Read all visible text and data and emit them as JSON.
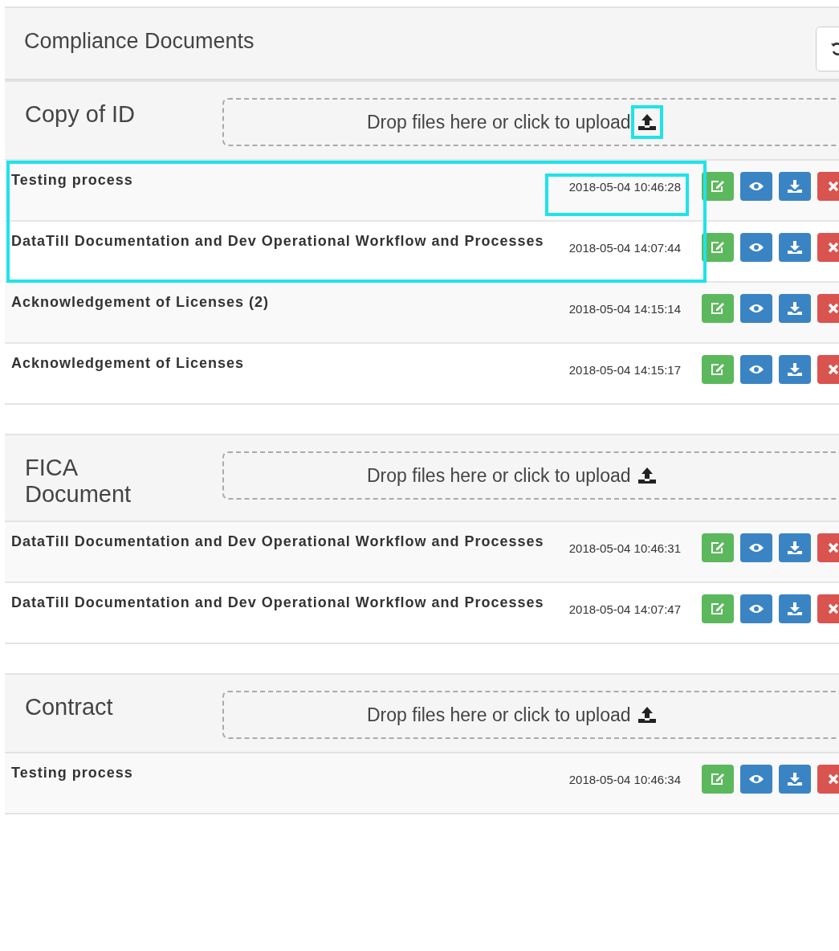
{
  "panel": {
    "title": "Compliance Documents"
  },
  "sections": [
    {
      "label": "Copy of ID",
      "upload": {
        "text": "Drop files here or click to upload",
        "icon_highlighted": true
      },
      "files": [
        {
          "title": "Testing process",
          "date": "2018-05-04 10:46:28",
          "highlighted": true,
          "date_highlighted": true
        },
        {
          "title": "DataTill Documentation and Dev Operational Workflow and Processes",
          "date": "2018-05-04 14:07:44",
          "highlighted": true,
          "date_highlighted": false
        },
        {
          "title": "Acknowledgement of Licenses (2)",
          "date": "2018-05-04 14:15:14",
          "highlighted": false,
          "date_highlighted": false
        },
        {
          "title": "Acknowledgement of Licenses",
          "date": "2018-05-04 14:15:17",
          "highlighted": false,
          "date_highlighted": false
        }
      ]
    },
    {
      "label": "FICA Document",
      "upload": {
        "text": "Drop files here or click to upload",
        "icon_highlighted": false
      },
      "files": [
        {
          "title": "DataTill Documentation and Dev Operational Workflow and Processes",
          "date": "2018-05-04 10:46:31",
          "highlighted": false,
          "date_highlighted": false
        },
        {
          "title": "DataTill Documentation and Dev Operational Workflow and Processes",
          "date": "2018-05-04 14:07:47",
          "highlighted": false,
          "date_highlighted": false
        }
      ]
    },
    {
      "label": "Contract",
      "upload": {
        "text": "Drop files here or click to upload",
        "icon_highlighted": false
      },
      "files": [
        {
          "title": "Testing process",
          "date": "2018-05-04 10:46:34",
          "highlighted": false,
          "date_highlighted": false
        }
      ]
    }
  ]
}
